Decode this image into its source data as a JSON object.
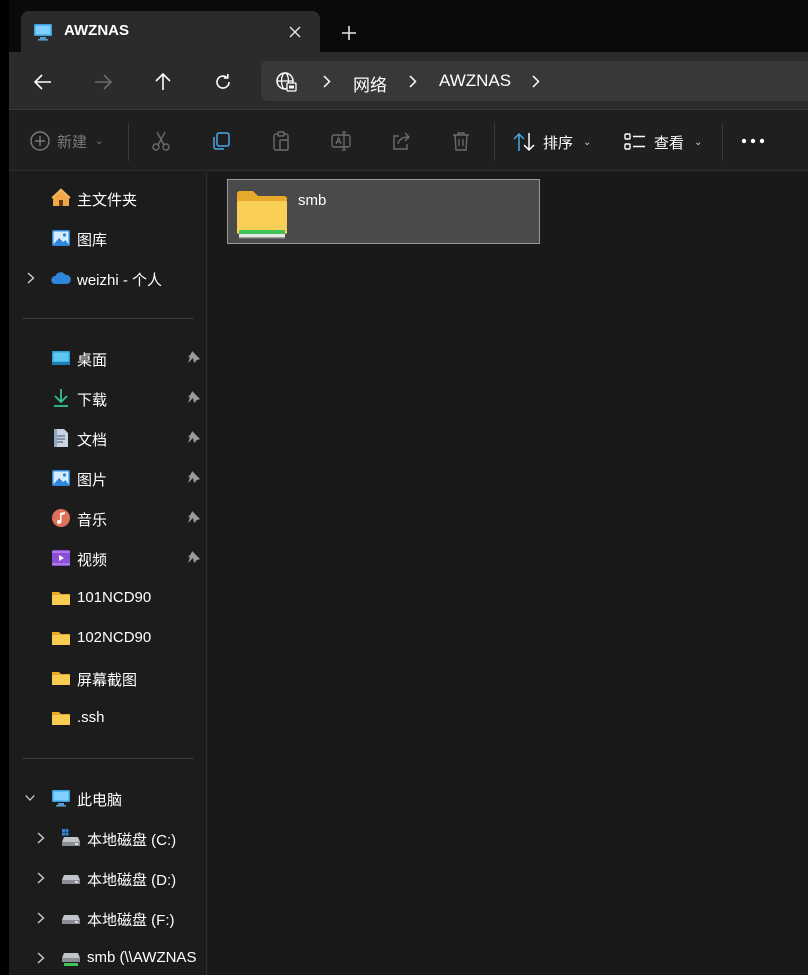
{
  "window": {
    "tab_title": "AWZNAS",
    "icons": {
      "tab": "monitor-icon",
      "close": "close-icon",
      "new_tab": "plus-icon"
    }
  },
  "navigation": {
    "buttons": [
      "back",
      "forward",
      "up",
      "refresh"
    ],
    "breadcrumb": [
      "网络",
      "AWZNAS"
    ]
  },
  "toolbar": {
    "new_label": "新建",
    "sort_label": "排序",
    "view_label": "查看",
    "icons": [
      "cut-icon",
      "copy-icon",
      "paste-icon",
      "rename-icon",
      "share-icon",
      "delete-icon",
      "more-icon"
    ]
  },
  "sidebar": {
    "quick": [
      {
        "label": "主文件夹",
        "icon": "home-icon"
      },
      {
        "label": "图库",
        "icon": "gallery-icon"
      },
      {
        "label": "weizhi - 个人",
        "icon": "onedrive-icon",
        "expandable": true
      }
    ],
    "pinned": [
      {
        "label": "桌面",
        "icon": "desktop-icon",
        "pinned": true
      },
      {
        "label": "下载",
        "icon": "download-icon",
        "pinned": true
      },
      {
        "label": "文档",
        "icon": "document-icon",
        "pinned": true
      },
      {
        "label": "图片",
        "icon": "pictures-icon",
        "pinned": true
      },
      {
        "label": "音乐",
        "icon": "music-icon",
        "pinned": true
      },
      {
        "label": "视频",
        "icon": "video-icon",
        "pinned": true
      },
      {
        "label": "101NCD90",
        "icon": "folder-icon",
        "pinned": false
      },
      {
        "label": "102NCD90",
        "icon": "folder-icon",
        "pinned": false
      },
      {
        "label": "屏幕截图",
        "icon": "folder-icon",
        "pinned": false
      },
      {
        "label": ".ssh",
        "icon": "folder-icon",
        "pinned": false
      }
    ],
    "this_pc": {
      "label": "此电脑",
      "drives": [
        {
          "label": "本地磁盘 (C:)",
          "icon": "system-drive-icon"
        },
        {
          "label": "本地磁盘 (D:)",
          "icon": "drive-icon"
        },
        {
          "label": "本地磁盘 (F:)",
          "icon": "drive-icon"
        },
        {
          "label": "smb (\\\\AWZNAS",
          "icon": "network-drive-icon"
        }
      ]
    }
  },
  "content": {
    "items": [
      {
        "name": "smb",
        "icon": "network-share-folder-icon",
        "selected": true
      }
    ]
  },
  "colors": {
    "window_bg": "#1c1c1c",
    "folder_yellow": "#f7c948",
    "share_green": "#3fc25a",
    "selected_tile": "#4a4a4a"
  }
}
